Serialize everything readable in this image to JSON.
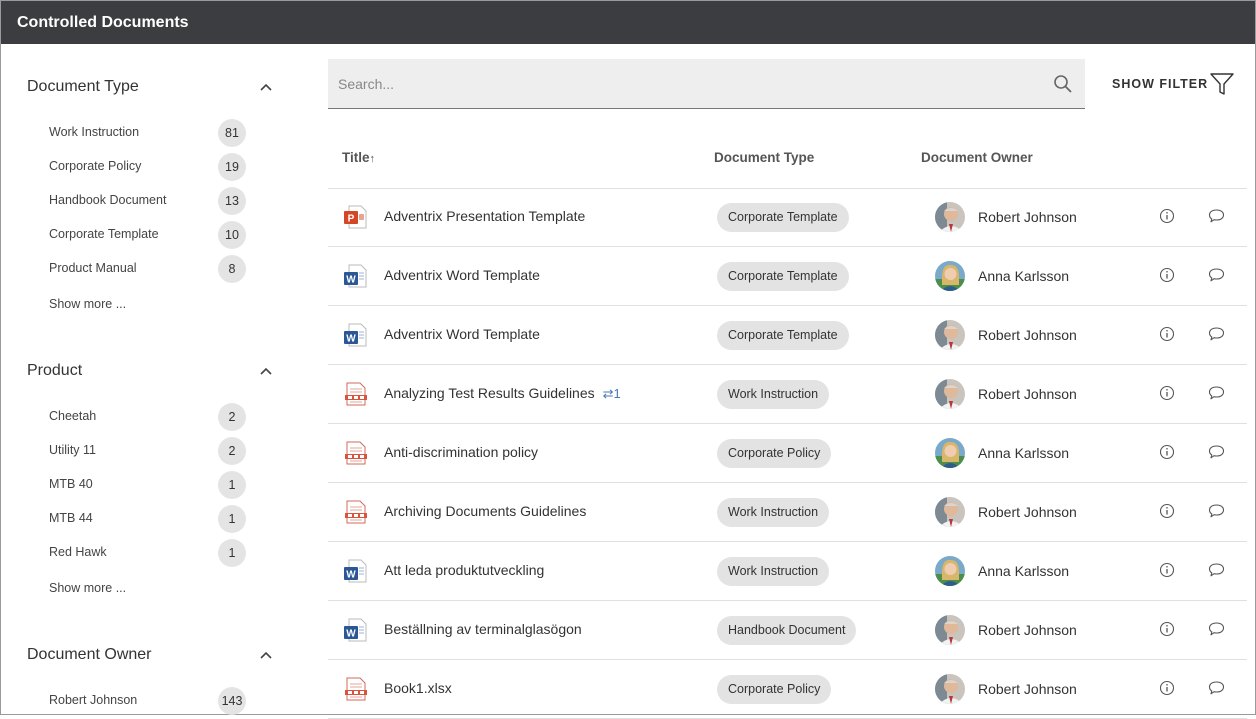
{
  "app": {
    "title": "Controlled Documents"
  },
  "sidebar": {
    "facets": [
      {
        "title": "Document Type",
        "items": [
          {
            "label": "Work Instruction",
            "count": "81"
          },
          {
            "label": "Corporate Policy",
            "count": "19"
          },
          {
            "label": "Handbook Document",
            "count": "13"
          },
          {
            "label": "Corporate Template",
            "count": "10"
          },
          {
            "label": "Product Manual",
            "count": "8"
          }
        ],
        "show_more": "Show more ..."
      },
      {
        "title": "Product",
        "items": [
          {
            "label": "Cheetah",
            "count": "2"
          },
          {
            "label": "Utility 11",
            "count": "2"
          },
          {
            "label": "MTB 40",
            "count": "1"
          },
          {
            "label": "MTB 44",
            "count": "1"
          },
          {
            "label": "Red Hawk",
            "count": "1"
          }
        ],
        "show_more": "Show more ..."
      },
      {
        "title": "Document Owner",
        "items": [
          {
            "label": "Robert Johnson",
            "count": "143"
          }
        ]
      }
    ]
  },
  "search": {
    "placeholder": "Search..."
  },
  "filter": {
    "label": "SHOW FILTER"
  },
  "table": {
    "headers": {
      "title": "Title",
      "title_sort": "↑",
      "type": "Document Type",
      "owner": "Document Owner"
    },
    "rows": [
      {
        "icon": "powerpoint-file-icon",
        "title": "Adventrix Presentation Template",
        "links": "",
        "type": "Corporate Template",
        "owner": "Robert Johnson"
      },
      {
        "icon": "word-file-icon",
        "title": "Adventrix Word Template",
        "links": "",
        "type": "Corporate Template",
        "owner": "Anna Karlsson"
      },
      {
        "icon": "word-file-icon",
        "title": "Adventrix Word Template",
        "links": "",
        "type": "Corporate Template",
        "owner": "Robert Johnson"
      },
      {
        "icon": "pdf-file-icon",
        "title": "Analyzing Test Results Guidelines",
        "links": "⇄1",
        "type": "Work Instruction",
        "owner": "Robert Johnson"
      },
      {
        "icon": "pdf-file-icon",
        "title": "Anti-discrimination policy",
        "links": "",
        "type": "Corporate Policy",
        "owner": "Anna Karlsson"
      },
      {
        "icon": "pdf-file-icon",
        "title": "Archiving Documents Guidelines",
        "links": "",
        "type": "Work Instruction",
        "owner": "Robert Johnson"
      },
      {
        "icon": "word-file-icon",
        "title": "Att leda produktutveckling",
        "links": "",
        "type": "Work Instruction",
        "owner": "Anna Karlsson"
      },
      {
        "icon": "word-file-icon",
        "title": "Beställning av terminalglasögon",
        "links": "",
        "type": "Handbook Document",
        "owner": "Robert Johnson"
      },
      {
        "icon": "pdf-file-icon",
        "title": "Book1.xlsx",
        "links": "",
        "type": "Corporate Policy",
        "owner": "Robert Johnson"
      }
    ]
  },
  "colors": {
    "titlebar": "#3b3d40",
    "chip": "#e3e3e3",
    "link_badge": "#4a78b5"
  }
}
